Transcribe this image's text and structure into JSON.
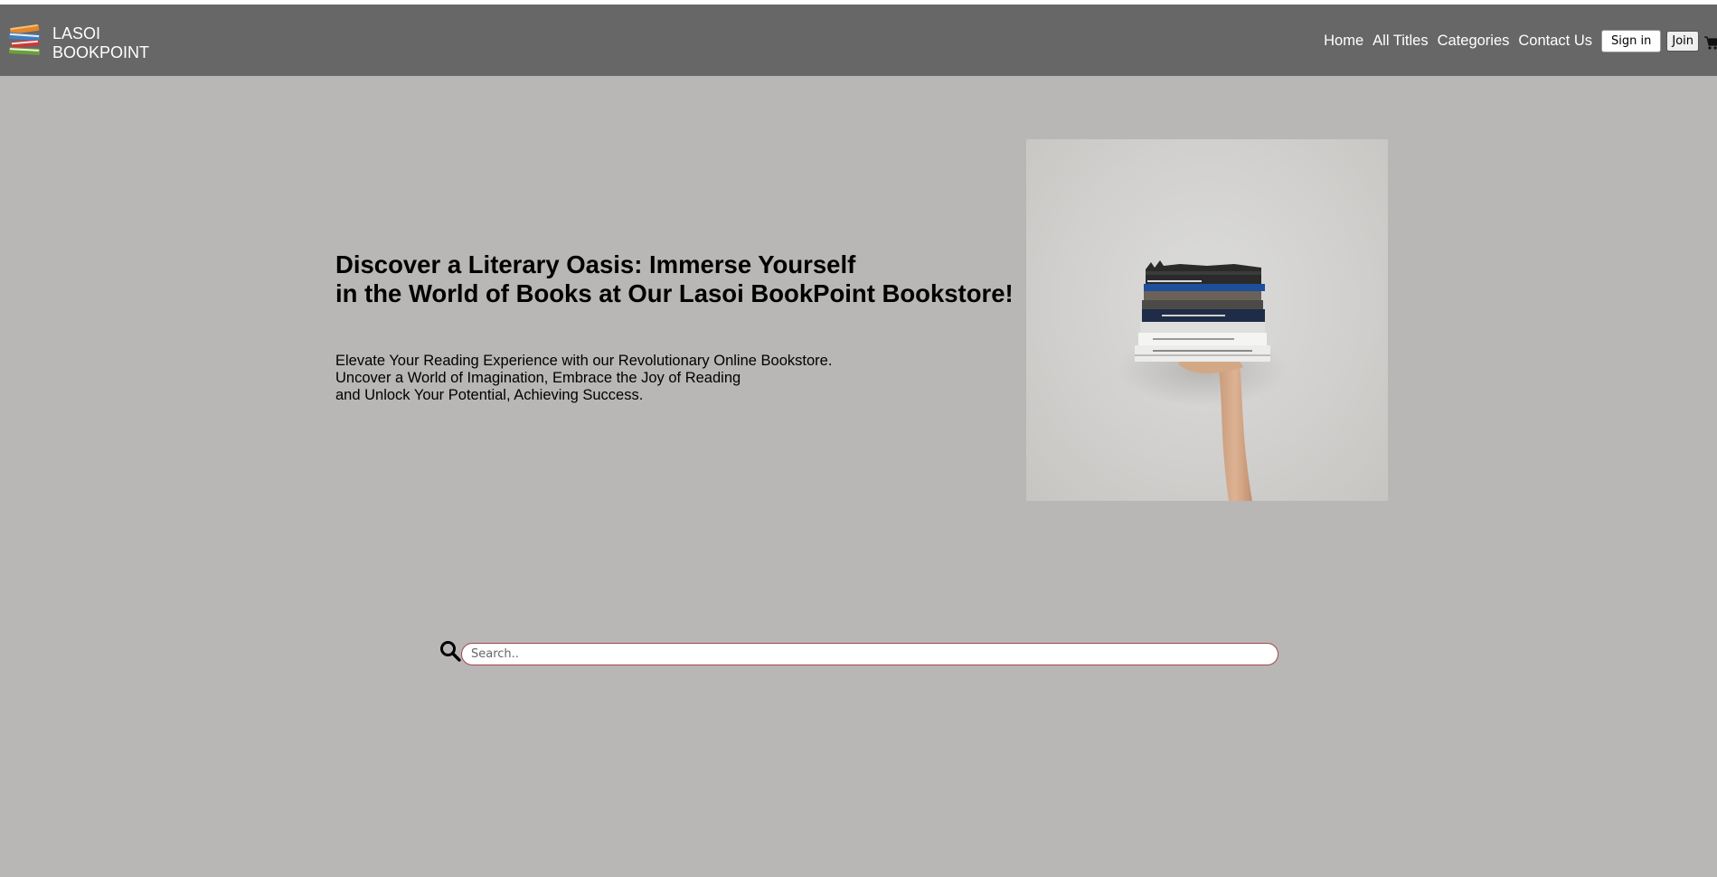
{
  "brand": {
    "line1": "LASOI",
    "line2": "BOOKPOINT",
    "logo_icon": "books-stack-icon"
  },
  "nav": {
    "links": [
      "Home",
      "All Titles",
      "Categories",
      "Contact Us"
    ],
    "signin_label": "Sign in",
    "join_label": "Join",
    "cart_icon": "cart-icon"
  },
  "hero": {
    "title_line1": "Discover a Literary Oasis: Immerse Yourself",
    "title_line2": "in the World of Books at Our Lasoi BookPoint Bookstore!",
    "sub_line1": "Elevate Your Reading Experience with our Revolutionary Online Bookstore.",
    "sub_line2": "Uncover a World of Imagination, Embrace the Joy of Reading",
    "sub_line3": "and Unlock Your Potential, Achieving Success."
  },
  "search": {
    "placeholder": "Search..",
    "value": ""
  },
  "colors": {
    "page_bg": "#b8b7b5",
    "navbar_bg": "#676767",
    "search_border": "#a5464e"
  }
}
